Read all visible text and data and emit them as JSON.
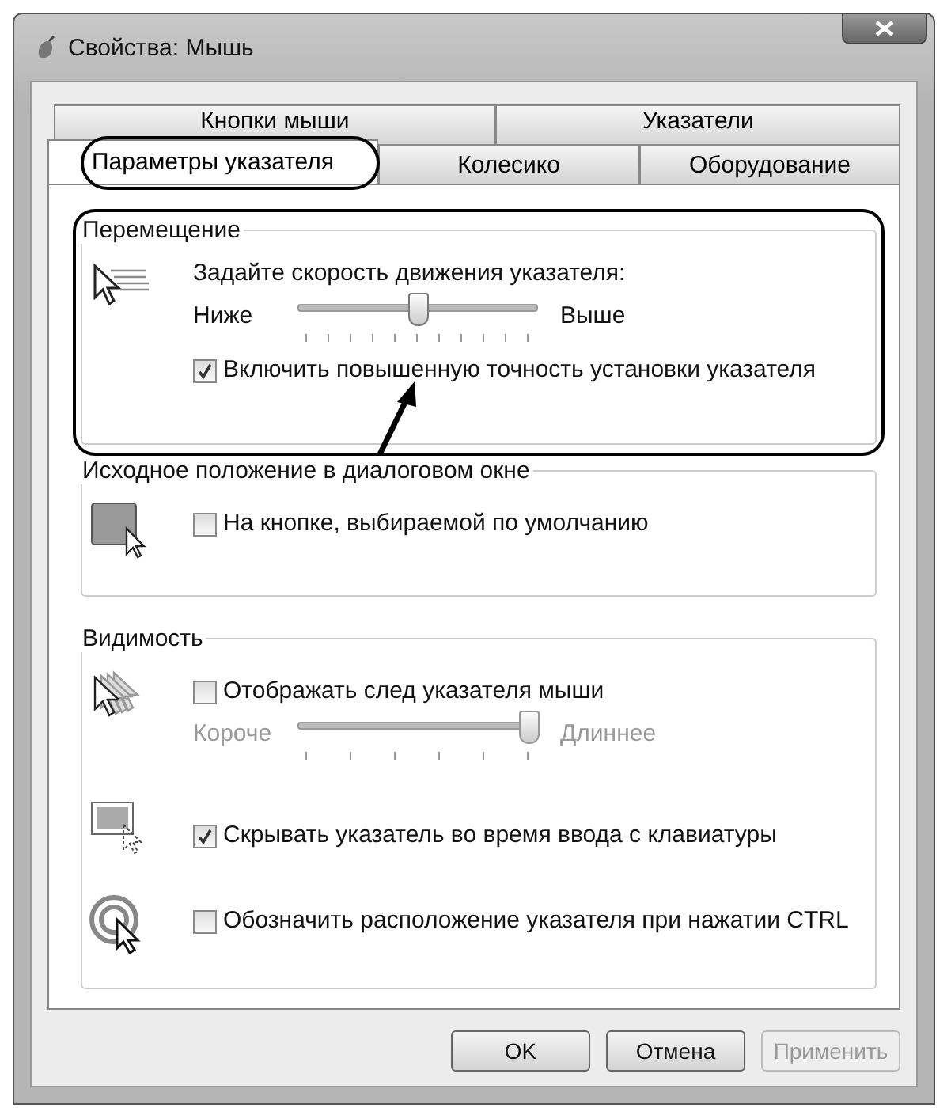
{
  "window": {
    "title": "Свойства: Мышь"
  },
  "tab_rows": [
    [
      {
        "label": "Кнопки мыши",
        "selected": false
      },
      {
        "label": "Указатели",
        "selected": false
      }
    ],
    [
      {
        "label": "Параметры указателя",
        "selected": true
      },
      {
        "label": "Колесико",
        "selected": false
      },
      {
        "label": "Оборудование",
        "selected": false
      }
    ]
  ],
  "motion": {
    "title": "Перемещение",
    "prompt": "Задайте скорость движения указателя:",
    "slider": {
      "low_label": "Ниже",
      "high_label": "Выше",
      "level": 0.5
    },
    "checkbox": {
      "label": "Включить повышенную точность установки указателя",
      "checked": true
    }
  },
  "snap": {
    "title": "Исходное положение в диалоговом окне",
    "checkbox": {
      "label": "На кнопке, выбираемой по умолчанию",
      "checked": false
    }
  },
  "visibility": {
    "title": "Видимость",
    "trail": {
      "label": "Отображать след указателя мыши",
      "checked": false
    },
    "trail_slider": {
      "low_label": "Короче",
      "high_label": "Длиннее",
      "level": 1,
      "disabled": true
    },
    "hide": {
      "label": "Скрывать указатель во время ввода с клавиатуры",
      "checked": true
    },
    "ctrl": {
      "label": "Обозначить расположение указателя при нажатии CTRL",
      "checked": false
    }
  },
  "buttons": [
    {
      "label": "OK",
      "disabled": false
    },
    {
      "label": "Отмена",
      "disabled": false
    },
    {
      "label": "Применить",
      "disabled": true
    }
  ]
}
